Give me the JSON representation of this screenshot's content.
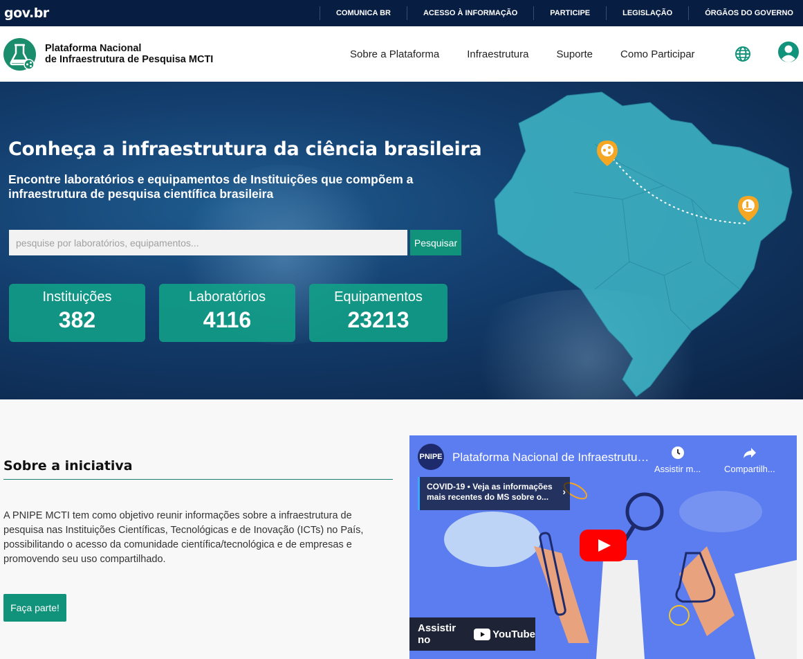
{
  "govbar": {
    "logo": "gov.br",
    "links": [
      "COMUNICA BR",
      "ACESSO À INFORMAÇÃO",
      "PARTICIPE",
      "LEGISLAÇÃO",
      "ÓRGÃOS DO GOVERNO"
    ]
  },
  "header": {
    "brand_line1": "Plataforma Nacional",
    "brand_line2": "de Infraestrutura de Pesquisa MCTI",
    "nav": [
      "Sobre a Plataforma",
      "Infraestrutura",
      "Suporte",
      "Como Participar"
    ],
    "icons": [
      "globe-icon",
      "user-icon"
    ]
  },
  "hero": {
    "title": "Conheça a infraestrutura da ciência brasileira",
    "subtitle": "Encontre laboratórios e equipamentos de Instituições que compõem a infraestrutura de pesquisa científica brasileira",
    "search_placeholder": "pesquise por laboratórios, equipamentos...",
    "search_button": "Pesquisar",
    "stats": [
      {
        "label": "Instituições",
        "value": "382"
      },
      {
        "label": "Laboratórios",
        "value": "4116"
      },
      {
        "label": "Equipamentos",
        "value": "23213"
      }
    ]
  },
  "about": {
    "title": "Sobre a iniciativa",
    "text": "A PNIPE MCTI tem como objetivo reunir informações sobre a infraestrutura de pesquisa nas Instituições Científicas, Tecnológicas e de Inovação (ICTs) no País, possibilitando o acesso da comunidade científica/tecnológica e de empresas e promovendo seu uso compartilhado.",
    "button": "Faça parte!"
  },
  "video": {
    "channel": "PNIPE",
    "title": "Plataforma Nacional de Infraestrutura de Pesquisa MCTI",
    "watch_later": "Assistir m...",
    "share": "Compartilh...",
    "covid_text": "COVID-19 • Veja as informações mais recentes do MS sobre o...",
    "watch_on": "Assistir no",
    "youtube": "YouTube"
  },
  "colors": {
    "govbar": "#071d41",
    "accent": "#10937a",
    "stat_bg": "#11a087",
    "map": "#3fb8c8",
    "pin": "#f5a623"
  }
}
